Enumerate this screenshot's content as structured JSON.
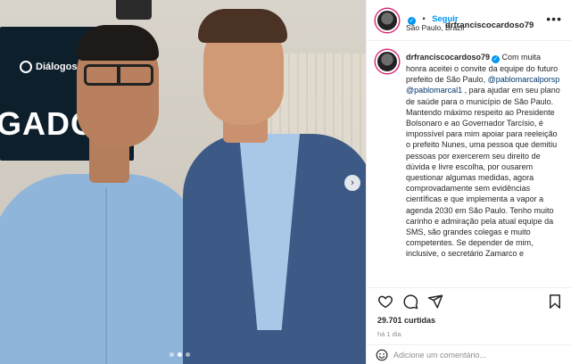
{
  "photo": {
    "backdrop_brand": "Diálogos Saúde",
    "backdrop_big_text": "GADO",
    "carousel_next_icon": "chevron-right-icon",
    "carousel_next_glyph": "›",
    "dots_total": 3,
    "active_dot": 1
  },
  "header": {
    "username": "drfranciscocardoso79",
    "separator": "•",
    "follow_label": "Seguir",
    "location": "São Paulo, Brazil",
    "more_glyph": "•••"
  },
  "caption": {
    "username": "drfranciscocardoso79",
    "text_1": " Com muita honra aceitei o convite da equipe do futuro prefeito de São Paulo, ",
    "mention_1": "@pablomarcalporsp",
    "mention_2": "@pablomarcal1",
    "text_2": " , para ajudar em seu plano de saúde para o município de São Paulo. Mantendo máximo respeito ao Presidente Bolsonaro e ao Governador Tarcísio, é impossível para mim apoiar para reeleição o prefeito Nunes, uma pessoa que demitiu pessoas por exercerem seu direito de dúvida e livre escolha, por ousarem questionar algumas medidas, agora comprovadamente sem evidências científicas e que implementa a vapor a agenda 2030 em São Paulo. Tenho muito carinho e admiração pela atual equipe da SMS, são grandes colegas e muito competentes. Se depender de mim, inclusive, o secretário Zamarco e"
  },
  "actions": {
    "icons": [
      "heart-icon",
      "comment-icon",
      "share-icon",
      "bookmark-icon"
    ]
  },
  "likes": "29.701 curtidas",
  "time": "há 1 dia",
  "comment": {
    "placeholder": "Adicione um comentário...",
    "emoji_icon": "emoji-icon"
  },
  "colors": {
    "accent": "#0095f6",
    "mention": "#00376b",
    "muted": "#8e8e8e",
    "text": "#262626"
  }
}
